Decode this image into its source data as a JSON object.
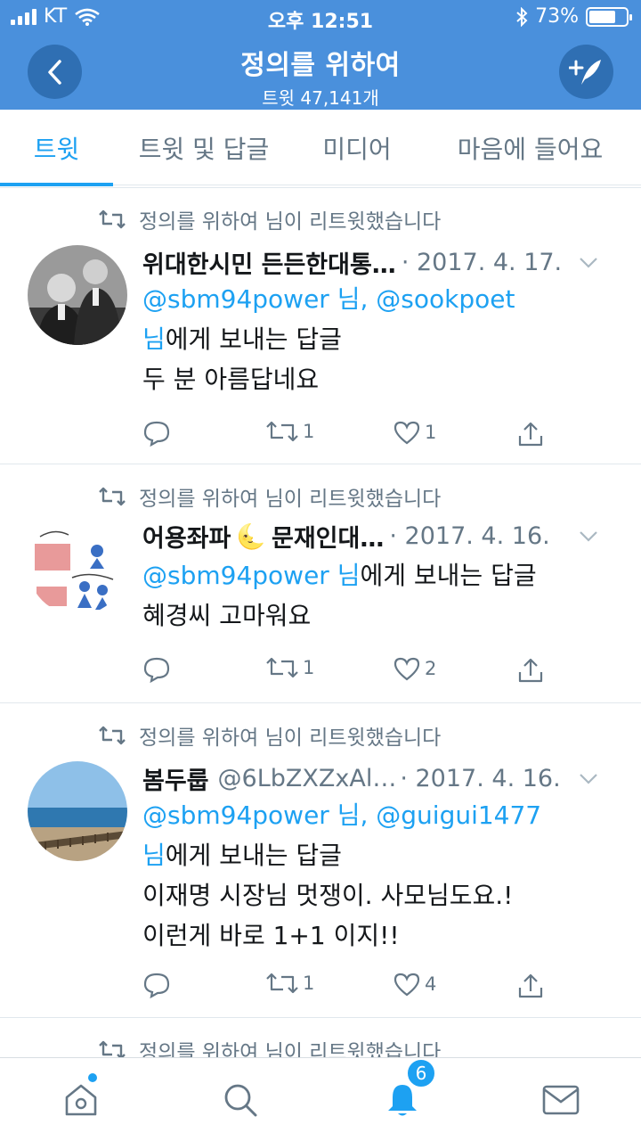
{
  "status_bar": {
    "carrier": "KT",
    "time": "오후 12:51",
    "battery": "73%",
    "battery_level": 0.73
  },
  "header": {
    "title": "정의를 위하여",
    "subtitle": "트윗 47,141개",
    "back_icon": "chevron-left-icon",
    "compose_icon": "compose-tweet-icon",
    "color": "#4a90dc"
  },
  "tabs": [
    {
      "label": "트윗",
      "active": true
    },
    {
      "label": "트윗 및 답글",
      "active": false
    },
    {
      "label": "미디어",
      "active": false
    },
    {
      "label": "마음에 들어요",
      "active": false
    }
  ],
  "tweets": [
    {
      "retweet_label": "정의를 위하여 님이 리트윗했습니다",
      "name": "위대한시민 든든한대통…",
      "handle": "",
      "date": "· 2017. 4. 17.",
      "reply_to_a": "@sbm94power 님, @sookpoet",
      "reply_to_b": "님",
      "reply_suffix": "에게 보내는 답글",
      "text_1": "두 분 아름답네요",
      "text_2": "",
      "retweets": "1",
      "likes": "1"
    },
    {
      "retweet_label": "정의를 위하여 님이 리트윗했습니다",
      "name": "어용좌파",
      "name_emoji": "🌜",
      "name_2": "문재인대…",
      "date": "· 2017. 4. 16.",
      "reply_to_a": "@sbm94power 님",
      "reply_suffix": "에게 보내는 답글",
      "text_1": "혜경씨 고마워요",
      "retweets": "1",
      "likes": "2"
    },
    {
      "retweet_label": "정의를 위하여 님이 리트윗했습니다",
      "name": "봄두룹",
      "handle": "@6LbZXZxAl…",
      "date": "· 2017. 4. 16.",
      "reply_to_a": "@sbm94power 님, @guigui1477",
      "reply_to_b": "님",
      "reply_suffix": "에게 보내는 답글",
      "text_1": "이재명 시장님 멋쟁이.  사모님도요.!",
      "text_2": "이런게 바로 1+1 이지!!",
      "retweets": "1",
      "likes": "4"
    },
    {
      "retweet_label": "정의를 위하여 님이 리트윗했습니다"
    }
  ],
  "bottom_nav": {
    "notifications_badge": "6",
    "accent": "#1da1f2"
  }
}
